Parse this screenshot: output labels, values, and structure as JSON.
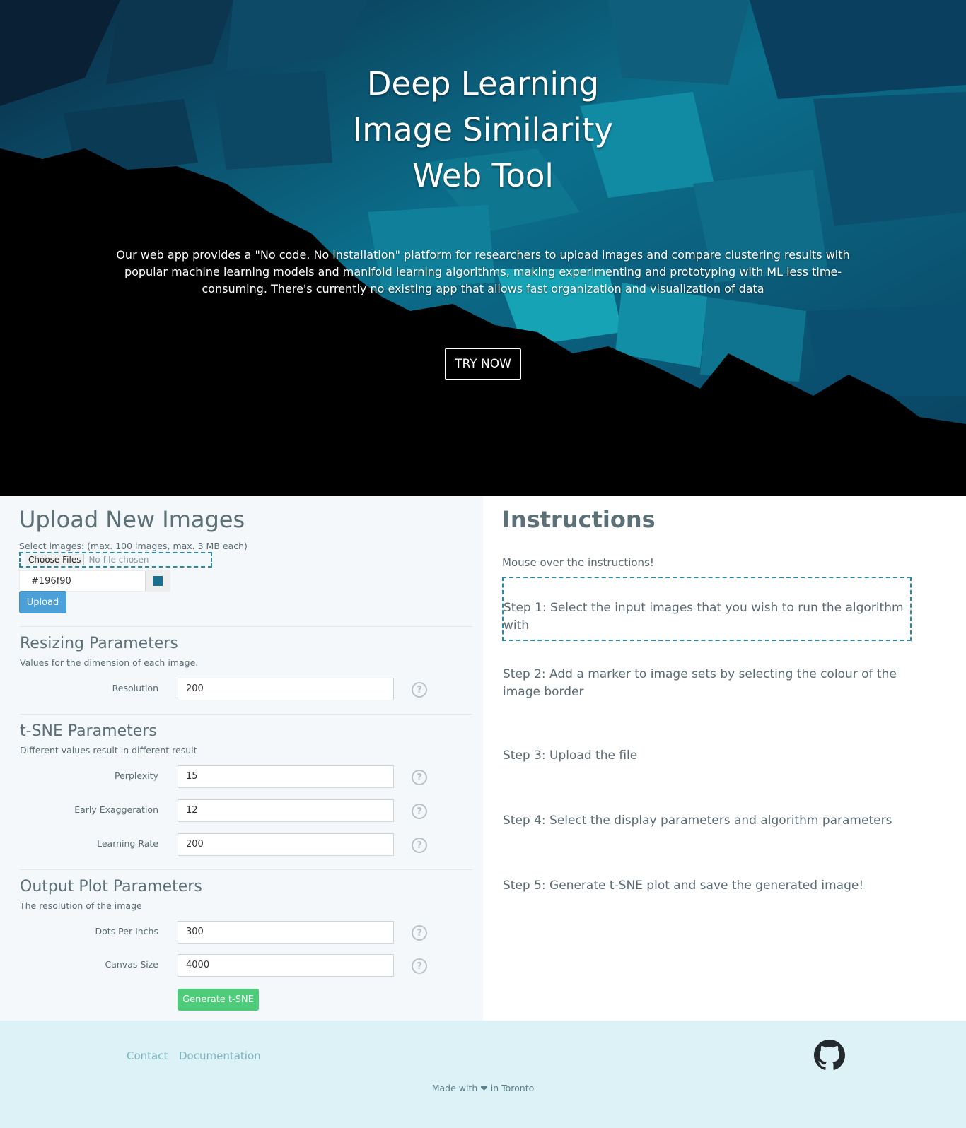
{
  "hero": {
    "title_line1": "Deep Learning",
    "title_line2": "Image Similarity",
    "title_line3": "Web Tool",
    "description": "Our web app provides a \"No code. No installation\" platform for researchers to upload images and compare clustering results with popular machine learning models and manifold learning algorithms, making experimenting and prototyping with ML less time-consuming. There's currently no existing app that allows fast organization and visualization of data",
    "cta_label": "TRY NOW"
  },
  "upload": {
    "heading": "Upload New Images",
    "select_label": "Select images: (max. 100 images, max. 3 MB each)",
    "choose_files_label": "Choose Files",
    "file_status": "No file chosen",
    "color_value": "#196f90",
    "upload_label": "Upload"
  },
  "resizing": {
    "title": "Resizing Parameters",
    "subtitle": "Values for the dimension of each image.",
    "fields": [
      {
        "label": "Resolution",
        "value": "200"
      }
    ]
  },
  "tsne": {
    "title": "t-SNE Parameters",
    "subtitle": "Different values result in different result",
    "fields": [
      {
        "label": "Perplexity",
        "value": "15"
      },
      {
        "label": "Early Exaggeration",
        "value": "12"
      },
      {
        "label": "Learning Rate",
        "value": "200"
      }
    ]
  },
  "output": {
    "title": "Output Plot Parameters",
    "subtitle": "The resolution of the image",
    "fields": [
      {
        "label": "Dots Per Inchs",
        "value": "300"
      },
      {
        "label": "Canvas Size",
        "value": "4000"
      }
    ],
    "generate_label": "Generate t-SNE"
  },
  "instructions": {
    "heading": "Instructions",
    "hint": "Mouse over the instructions!",
    "steps": [
      "Step 1: Select the input images that you wish to run the algorithm with",
      "Step 2: Add a marker to image sets by selecting the colour of the image border",
      "Step 3: Upload the file",
      "Step 4: Select the display parameters and algorithm parameters",
      "Step 5: Generate t-SNE plot and save the generated image!"
    ]
  },
  "footer": {
    "contact": "Contact",
    "documentation": "Documentation",
    "made_prefix": "Made with",
    "heart": "❤",
    "made_suffix": "in Toronto",
    "github_icon": "github-icon"
  },
  "colors": {
    "accent": "#196f90",
    "upload_button": "#4ba0d8",
    "generate_button": "#4fcc7a",
    "footer_bg": "#dcf2f6"
  }
}
